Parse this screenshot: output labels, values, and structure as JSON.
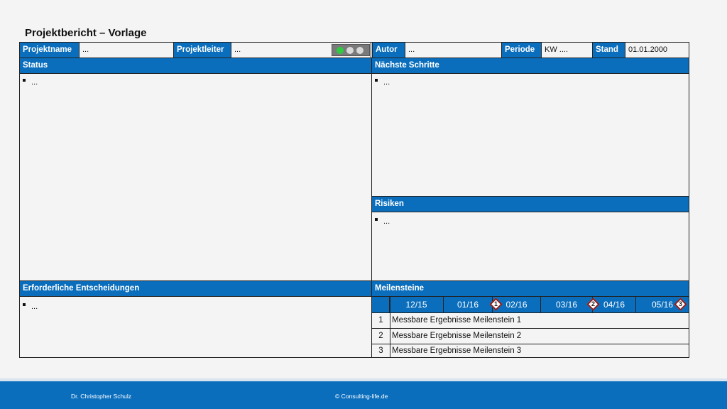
{
  "title": "Projektbericht – Vorlage",
  "header": {
    "projektname_label": "Projektname",
    "projektname_value": "...",
    "projektleiter_label": "Projektleiter",
    "projektleiter_value": "...",
    "autor_label": "Autor",
    "autor_value": "...",
    "periode_label": "Periode",
    "periode_value": "KW ....",
    "stand_label": "Stand",
    "stand_value": "01.01.2000",
    "traffic_light": {
      "active": "green",
      "colors": {
        "green": "#2ecc40",
        "off": "#d9d9d9"
      }
    }
  },
  "sections": {
    "status": {
      "title": "Status",
      "bullets": [
        "..."
      ]
    },
    "next_steps": {
      "title": "Nächste Schritte",
      "bullets": [
        "..."
      ]
    },
    "risks": {
      "title": "Risiken",
      "bullets": [
        "..."
      ]
    },
    "decisions": {
      "title": "Erforderliche Entscheidungen",
      "bullets": [
        "..."
      ]
    },
    "milestones": {
      "title": "Meilensteine",
      "dates": [
        "12/15",
        "01/16",
        "02/16",
        "03/16",
        "04/16",
        "05/16"
      ],
      "markers": [
        "1",
        "2",
        "3"
      ],
      "rows": [
        {
          "num": "1",
          "text": "Messbare Ergebnisse Meilenstein 1"
        },
        {
          "num": "2",
          "text": "Messbare Ergebnisse Meilenstein 2"
        },
        {
          "num": "3",
          "text": "Messbare Ergebnisse Meilenstein 3"
        }
      ]
    }
  },
  "footer": {
    "author": "Dr. Christopher Schulz",
    "copyright": "© Consulting-life.de"
  },
  "colors": {
    "accent": "#0a6ebd",
    "marker_border": "#8b1a1a"
  }
}
